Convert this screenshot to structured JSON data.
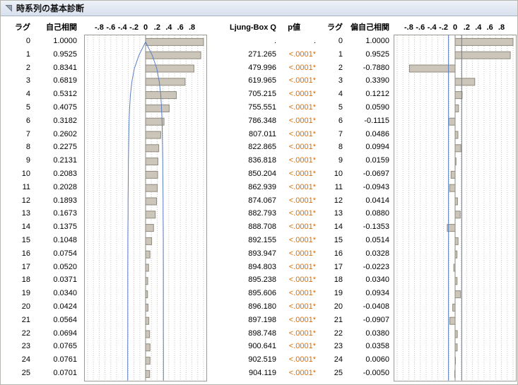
{
  "report": {
    "title": "時系列の基本診断"
  },
  "columns": {
    "lag_header": "ラグ",
    "acf_header": "自己相関",
    "ljung_box_header": "Ljung-Box Q",
    "pvalue_header": "p値",
    "lag2_header": "ラグ",
    "pacf_header": "偏自己相関"
  },
  "colors": {
    "p_value_text": "#d96c00",
    "bar_fill": "#cbc6b9",
    "bar_stroke": "#8f8a7d",
    "confidence_blue": "#5b7ec7"
  },
  "table": {
    "lags": [
      0,
      1,
      2,
      3,
      4,
      5,
      6,
      7,
      8,
      9,
      10,
      11,
      12,
      13,
      14,
      15,
      16,
      17,
      18,
      19,
      20,
      21,
      22,
      23,
      24,
      25
    ],
    "ljung_box_q": [
      null,
      271.265,
      479.996,
      619.965,
      705.215,
      755.551,
      786.348,
      807.011,
      822.865,
      836.818,
      850.204,
      862.939,
      874.067,
      882.793,
      888.708,
      892.155,
      893.947,
      894.803,
      895.238,
      895.606,
      896.18,
      897.198,
      898.748,
      900.641,
      902.519,
      904.119
    ],
    "p_values": [
      ".",
      "<.0001*",
      "<.0001*",
      "<.0001*",
      "<.0001*",
      "<.0001*",
      "<.0001*",
      "<.0001*",
      "<.0001*",
      "<.0001*",
      "<.0001*",
      "<.0001*",
      "<.0001*",
      "<.0001*",
      "<.0001*",
      "<.0001*",
      "<.0001*",
      "<.0001*",
      "<.0001*",
      "<.0001*",
      "<.0001*",
      "<.0001*",
      "<.0001*",
      "<.0001*",
      "<.0001*",
      "<.0001*"
    ],
    "missing_label": "."
  },
  "chart_data": [
    {
      "type": "bar",
      "name": "acf",
      "title": "自己相関",
      "orientation": "horizontal",
      "lags": [
        0,
        1,
        2,
        3,
        4,
        5,
        6,
        7,
        8,
        9,
        10,
        11,
        12,
        13,
        14,
        15,
        16,
        17,
        18,
        19,
        20,
        21,
        22,
        23,
        24,
        25
      ],
      "values": [
        1.0,
        0.9525,
        0.8341,
        0.6819,
        0.5312,
        0.4075,
        0.3182,
        0.2602,
        0.2275,
        0.2131,
        0.2083,
        0.2028,
        0.1893,
        0.1673,
        0.1375,
        0.1048,
        0.0754,
        0.052,
        0.0371,
        0.034,
        0.0424,
        0.0564,
        0.0694,
        0.0765,
        0.0761,
        0.0701
      ],
      "xlim": [
        -1.05,
        1.05
      ],
      "axis_ticks": [
        -0.8,
        -0.6,
        -0.4,
        -0.2,
        0,
        0.2,
        0.4,
        0.6,
        0.8
      ],
      "axis_tick_labels": [
        "-.8",
        "-.6",
        "-.4",
        "-.2",
        "0",
        ".2",
        ".4",
        ".6",
        ".8"
      ],
      "grid": "dotted vertical every 0.1",
      "confidence_bounds": [
        0,
        0.115,
        0.194,
        0.237,
        0.262,
        0.276,
        0.284,
        0.289,
        0.293,
        0.296,
        0.298,
        0.3,
        0.302,
        0.303,
        0.305,
        0.306,
        0.306,
        0.307,
        0.307,
        0.307,
        0.307,
        0.307,
        0.307,
        0.308,
        0.308,
        0.308
      ],
      "bar_fill": "#cbc6b9",
      "bar_stroke": "#8f8a7d",
      "curve_color": "#5b7ec7"
    },
    {
      "type": "bar",
      "name": "pacf",
      "title": "偏自己相関",
      "orientation": "horizontal",
      "lags": [
        0,
        1,
        2,
        3,
        4,
        5,
        6,
        7,
        8,
        9,
        10,
        11,
        12,
        13,
        14,
        15,
        16,
        17,
        18,
        19,
        20,
        21,
        22,
        23,
        24,
        25
      ],
      "values": [
        1.0,
        0.9525,
        -0.788,
        0.339,
        0.1212,
        0.059,
        -0.1115,
        0.0486,
        0.0994,
        0.0159,
        -0.0697,
        -0.0943,
        0.0414,
        0.088,
        -0.1353,
        0.0514,
        0.0328,
        -0.0223,
        0.034,
        0.0934,
        -0.0408,
        -0.0907,
        0.038,
        0.0358,
        0.006,
        -0.005
      ],
      "xlim": [
        -1.05,
        1.05
      ],
      "axis_ticks": [
        -0.8,
        -0.6,
        -0.4,
        -0.2,
        0,
        0.2,
        0.4,
        0.6,
        0.8
      ],
      "axis_tick_labels": [
        "-.8",
        "-.6",
        "-.4",
        "-.2",
        "0",
        ".2",
        ".4",
        ".6",
        ".8"
      ],
      "grid": "dotted vertical every 0.1",
      "confidence_limit": 0.115,
      "bar_fill": "#cbc6b9",
      "bar_stroke": "#8f8a7d",
      "curve_color": "#5b7ec7"
    }
  ]
}
